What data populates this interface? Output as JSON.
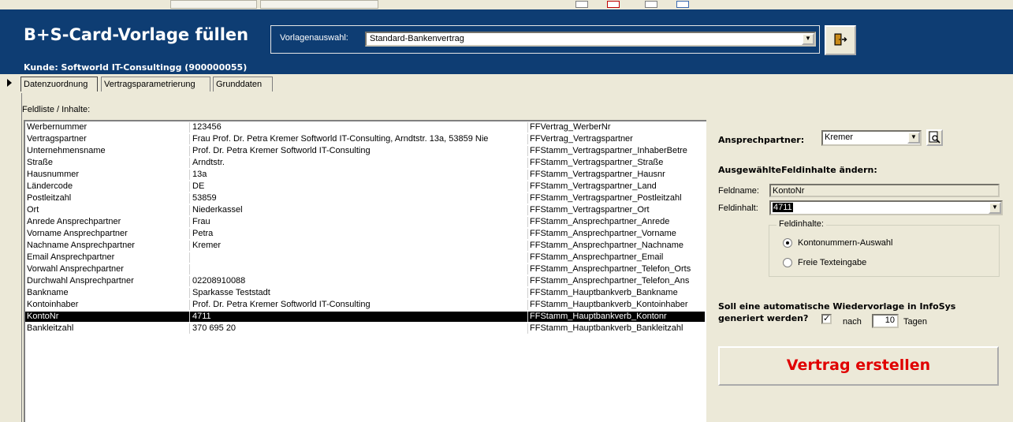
{
  "header": {
    "title": "B+S-Card-Vorlage füllen",
    "kunde": "Kunde: Softworld IT-Consultingg  (900000055)",
    "vorlage_label": "Vorlagenauswahl:",
    "vorlage_value": "Standard-Bankenvertrag",
    "exit_icon": "exit-door-icon"
  },
  "tabs": [
    {
      "label": "Datenzuordnung"
    },
    {
      "label": "Vertragsparametrierung"
    },
    {
      "label": "Grunddaten"
    }
  ],
  "list": {
    "label": "Feldliste / Inhalte:",
    "rows": [
      {
        "name": "Werbernummer",
        "value": "123456",
        "field": "FFVertrag_WerberNr"
      },
      {
        "name": "Vertragspartner",
        "value": "Frau Prof. Dr. Petra Kremer Softworld IT-Consulting, Arndtstr. 13a, 53859 Nie",
        "field": "FFVertrag_Vertragspartner"
      },
      {
        "name": "Unternehmensname",
        "value": "Prof. Dr. Petra Kremer Softworld IT-Consulting",
        "field": "FFStamm_Vertragspartner_InhaberBetre"
      },
      {
        "name": "Straße",
        "value": "Arndtstr.",
        "field": "FFStamm_Vertragspartner_Straße"
      },
      {
        "name": "Hausnummer",
        "value": "13a",
        "field": "FFStamm_Vertragspartner_Hausnr"
      },
      {
        "name": "Ländercode",
        "value": "DE",
        "field": "FFStamm_Vertragspartner_Land"
      },
      {
        "name": "Postleitzahl",
        "value": "53859",
        "field": "FFStamm_Vertragspartner_Postleitzahl"
      },
      {
        "name": "Ort",
        "value": "Niederkassel",
        "field": "FFStamm_Vertragspartner_Ort"
      },
      {
        "name": "Anrede Ansprechpartner",
        "value": "Frau",
        "field": "FFStamm_Ansprechpartner_Anrede"
      },
      {
        "name": "Vorname Ansprechpartner",
        "value": "Petra",
        "field": "FFStamm_Ansprechpartner_Vorname"
      },
      {
        "name": "Nachname Ansprechpartner",
        "value": "Kremer",
        "field": "FFStamm_Ansprechpartner_Nachname"
      },
      {
        "name": "Email Ansprechpartner",
        "value": "",
        "field": "FFStamm_Ansprechpartner_Email"
      },
      {
        "name": "Vorwahl Ansprechpartner",
        "value": "",
        "field": "FFStamm_Ansprechpartner_Telefon_Orts"
      },
      {
        "name": "Durchwahl Ansprechpartner",
        "value": "02208910088",
        "field": "FFStamm_Ansprechpartner_Telefon_Ans"
      },
      {
        "name": "Bankname",
        "value": "Sparkasse Teststadt",
        "field": "FFStamm_Hauptbankverb_Bankname"
      },
      {
        "name": "Kontoinhaber",
        "value": "Prof. Dr. Petra Kremer Softworld IT-Consulting",
        "field": "FFStamm_Hauptbankverb_Kontoinhaber"
      },
      {
        "name": "KontoNr",
        "value": "4711",
        "field": "FFStamm_Hauptbankverb_Kontonr",
        "selected": true
      },
      {
        "name": "Bankleitzahl",
        "value": "370 695 20",
        "field": "FFStamm_Hauptbankverb_Bankleitzahl"
      }
    ]
  },
  "right": {
    "ansprechpartner_label": "Ansprechpartner:",
    "ansprechpartner_value": "Kremer",
    "search_icon": "magnifier-document-icon",
    "aendern_heading": "AusgewählteFeldinhalte ändern:",
    "feldname_label": "Feldname:",
    "feldname_value": "KontoNr",
    "feldinhalt_label": "Feldinhalt:",
    "feldinhalt_value": "4711",
    "group_title": "Feldinhalte:",
    "radio1": "Kontonummern-Auswahl",
    "radio2": "Freie Texteingabe",
    "wiedervorlage_q1": "Soll eine automatische Wiedervorlage in InfoSys",
    "wiedervorlage_q2": "generiert werden?",
    "nach_label": "nach",
    "tage_value": "10",
    "tage_label": "Tagen",
    "create_button": "Vertrag erstellen"
  },
  "colors": {
    "header_bg": "#0e3d73",
    "create_text": "#e00000"
  }
}
